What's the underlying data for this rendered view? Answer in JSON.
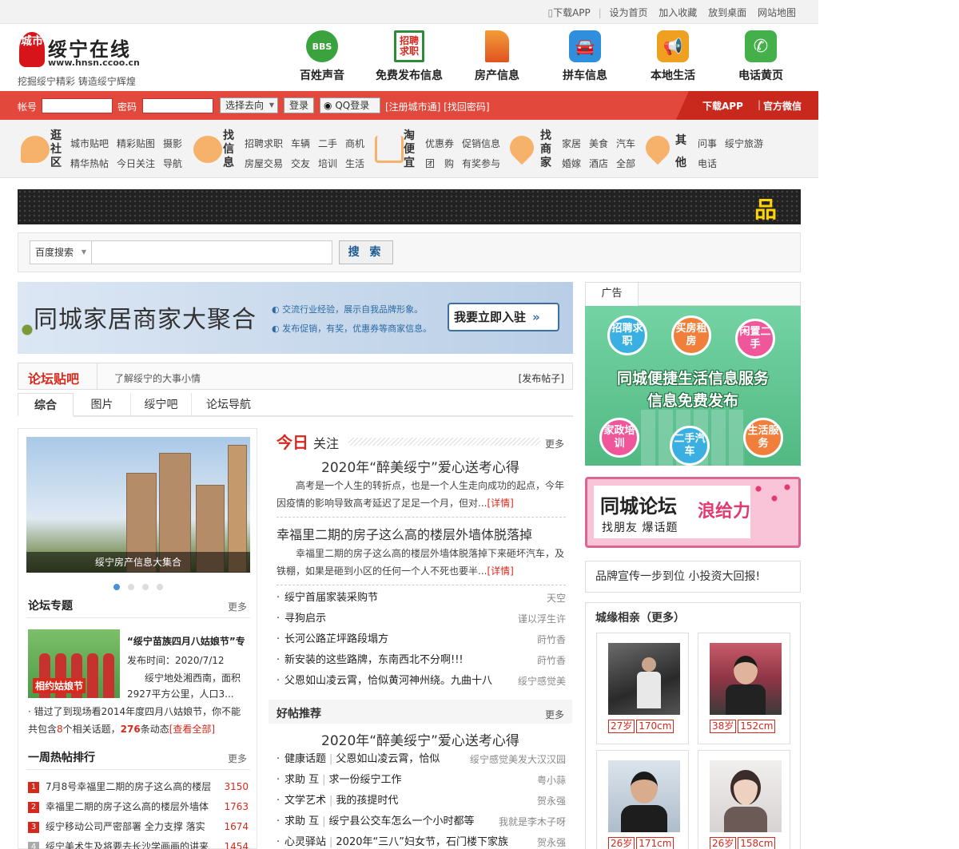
{
  "topbar": {
    "links": [
      "下载APP",
      "设为首页",
      "加入收藏",
      "放到桌面",
      "网站地图"
    ]
  },
  "header": {
    "logo_mark": "城市",
    "site_name": "绥宁在线",
    "site_url": "www.hnsn.ccoo.cn",
    "slogan": "挖掘绥宁精彩 铸造绥宁辉煌",
    "nav": [
      {
        "label": "百姓声音",
        "icon": "BBS",
        "color": "#3aa33e"
      },
      {
        "label": "免费发布信息",
        "icon": "招聘求职",
        "color": "#d7281c"
      },
      {
        "label": "房产信息",
        "icon": "house-icon",
        "color": "#e86b21"
      },
      {
        "label": "拼车信息",
        "icon": "car-icon",
        "color": "#2f8fdc"
      },
      {
        "label": "本地生活",
        "icon": "megaphone-icon",
        "color": "#f0a020"
      },
      {
        "label": "电话黄页",
        "icon": "phone-icon",
        "color": "#43b04a"
      }
    ]
  },
  "login": {
    "account_label": "帐号",
    "password_label": "密码",
    "goto_label": "选择去向",
    "login_button": "登录",
    "qq_button": "QQ登录",
    "register_links": "[注册城市通] [找回密码]",
    "download_app": "下载APP",
    "official_wechat": "官方微信"
  },
  "catnav": [
    {
      "title": "逛社区",
      "links": [
        [
          "城市贴吧",
          "精彩贴图",
          "摄影"
        ],
        [
          "精华热帖",
          "今日关注",
          "导航"
        ]
      ]
    },
    {
      "title": "找信息",
      "links": [
        [
          "招聘求职",
          "车辆",
          "二手",
          "商机"
        ],
        [
          "房屋交易",
          "交友",
          "培训",
          "生活"
        ]
      ]
    },
    {
      "title": "淘便宜",
      "links": [
        [
          "优惠券",
          "促销信息"
        ],
        [
          "团　购",
          "有奖参与"
        ]
      ]
    },
    {
      "title": "找商家",
      "links": [
        [
          "家居",
          "美食",
          "汽车"
        ],
        [
          "婚嫁",
          "酒店",
          "全部"
        ]
      ]
    },
    {
      "title": "其他",
      "links": [
        [
          "问事",
          "绥宁旅游"
        ],
        [
          "电话"
        ]
      ]
    }
  ],
  "strip": {
    "text": "品"
  },
  "search": {
    "engine": "百度搜索",
    "button": "搜 索",
    "placeholder": ""
  },
  "ad_banner": {
    "title": "同城家居商家大聚合",
    "line1": "交流行业经验，展示自我品牌形象。",
    "line2": "发布促销，有奖，优惠券等商家信息。",
    "cta": "我要立即入驻"
  },
  "forum": {
    "title": "论坛贴吧",
    "desc": "了解绥宁的大事小情",
    "post_link": "[发布帖子]",
    "tabs": [
      "综合",
      "图片",
      "绥宁吧",
      "论坛导航"
    ]
  },
  "left": {
    "photo_caption": "绥宁房产信息大集合",
    "topics_title": "论坛专题",
    "more": "更多",
    "topic_title": "“绥宁苗族四月八姑娘节”专",
    "topic_date": "发布时间：2020/7/12",
    "topic_desc1": "绥宁地处湘西南，面积",
    "topic_desc2": "2927平方公里，人口3...",
    "topic_pic_label": "相约姑娘节",
    "summary1": "· 错过了到现场看2014年度四月八姑娘节，你不能",
    "summary2_a": "共包含",
    "summary2_n1": "8",
    "summary2_b": "个相关话题，",
    "summary2_n2": "276",
    "summary2_c": "条动态",
    "summary2_link": "[查看全部]",
    "hot_title": "一周热帖排行",
    "hot": [
      {
        "rank": "1",
        "title": "7月8号幸福里二期的房子这么高的楼层",
        "count": "3150"
      },
      {
        "rank": "2",
        "title": "幸福里二期的房子这么高的楼层外墙体",
        "count": "1763"
      },
      {
        "rank": "3",
        "title": "绥宁移动公司严密部署 全力支撑 落实",
        "count": "1674"
      },
      {
        "rank": "4",
        "title": "绥宁美术生及将要去长沙学画画的讲来",
        "count": "1454"
      }
    ]
  },
  "middle": {
    "today_a": "今日",
    "today_b": "关注",
    "more": "更多",
    "headline1": "2020年“醉美绥宁”爱心送考心得",
    "para1": "高考是一个人生的转折点，也是一个人生走向成功的起点，今年因疫情的影响导致高考延迟了足足一个月，但对...",
    "detail": "[详情]",
    "headline2": "幸福里二期的房子这么高的楼层外墙体脱落掉",
    "para2": "幸福里二期的房子这么高的楼层外墙体脱落掉下来砸坏汽车，及铁棚，如果是砸到小区的任何一个人不死也要半...",
    "news": [
      {
        "title": "绥宁首届家装采购节",
        "author": "天空"
      },
      {
        "title": "寻狗启示",
        "author": "谨以浮生许"
      },
      {
        "title": "长河公路芷坪路段塌方",
        "author": "莳竹香"
      },
      {
        "title": "新安装的这些路牌，东南西北不分啊!!!",
        "author": "莳竹香"
      },
      {
        "title": "父恩如山凌云霄，恰似黄河神州绕。九曲十八",
        "author": "绥宁感觉美"
      }
    ],
    "good_title": "好帖推荐",
    "headline3": "2020年“醉美绥宁”爱心送考心得",
    "good": [
      {
        "cat": "健康话题",
        "title": "父恩如山凌云霄，恰似",
        "author": "绥宁感觉美发大汉汉园"
      },
      {
        "cat": "求助 互",
        "title": "求一份绥宁工作",
        "author": "粤小蒜"
      },
      {
        "cat": "文学艺术",
        "title": "我的孩提时代",
        "author": "贺永强"
      },
      {
        "cat": "求助 互",
        "title": "绥宁县公交车怎么一个小时都等",
        "author": "我就是李木子呀"
      },
      {
        "cat": "心灵驿站",
        "title": "2020年“三八”妇女节，石门楼下家族",
        "author": "贺永强"
      }
    ]
  },
  "right": {
    "ad_tab": "广告",
    "green_ad": {
      "bubbles": [
        "招聘求职",
        "买房租房",
        "闲置二手",
        "家政培训",
        "二手汽车",
        "生活服务"
      ],
      "line1": "同城便捷生活信息服务",
      "line2": "信息免费发布"
    },
    "pink_ad": {
      "title": "同城论坛",
      "sub": "找朋友 爆话题",
      "slogan": "浪给力"
    },
    "brand_line": "品牌宣传一步到位 小投资大回报!",
    "dating_title": "城缘相亲（更多）",
    "people": [
      {
        "age": "27岁",
        "height": "170cm"
      },
      {
        "age": "38岁",
        "height": "152cm"
      },
      {
        "age": "26岁",
        "height": "171cm"
      },
      {
        "age": "26岁",
        "height": "158cm"
      }
    ]
  }
}
